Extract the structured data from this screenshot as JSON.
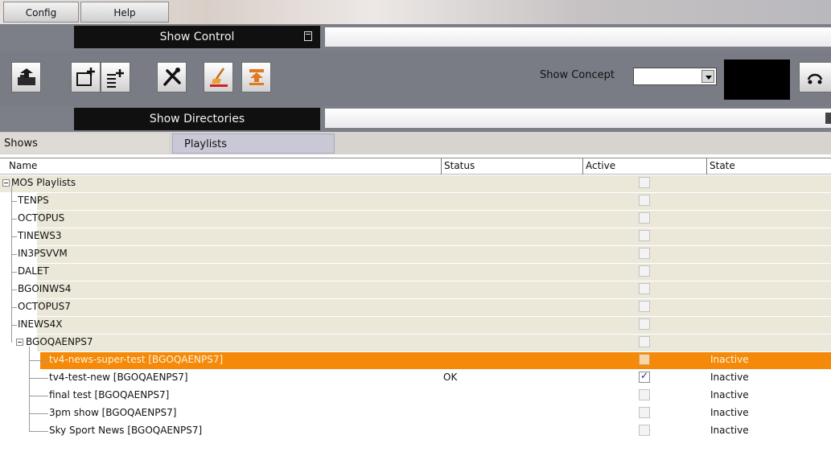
{
  "menu": {
    "config": "Config",
    "help": "Help"
  },
  "show_control": {
    "title": "Show Control",
    "minimize_icon": "window-restore-icon"
  },
  "toolbar": {
    "buttons": [
      {
        "name": "export-button",
        "icon": "export-icon"
      },
      {
        "name": "add-show-button",
        "icon": "add-window-icon"
      },
      {
        "name": "add-playlist-button",
        "icon": "add-list-icon"
      },
      {
        "name": "tools-button",
        "icon": "tools-icon"
      },
      {
        "name": "clean-button",
        "icon": "broom-icon"
      },
      {
        "name": "import-button",
        "icon": "import-icon"
      }
    ],
    "show_concept_label": "Show Concept",
    "show_concept_value": "",
    "end_icon": "disconnect-icon"
  },
  "show_directories": {
    "title": "Show Directories"
  },
  "tabs": {
    "shows": "Shows",
    "playlists": "Playlists"
  },
  "table": {
    "columns": [
      "Name",
      "Status",
      "Active",
      "State"
    ],
    "root": "MOS Playlists",
    "groups": [
      "TENPS",
      "OCTOPUS",
      "TINEWS3",
      "IN3PSVVM",
      "DALET",
      "BGOINWS4",
      "OCTOPUS7",
      "INEWS4X"
    ],
    "expanded_group": "BGOQAENPS7",
    "playlists": [
      {
        "name": "tv4-news-super-test [BGOQAENPS7]",
        "status": "",
        "active": false,
        "state": "Inactive",
        "selected": true
      },
      {
        "name": "tv4-test-new [BGOQAENPS7]",
        "status": "OK",
        "active": true,
        "state": "Inactive",
        "selected": false
      },
      {
        "name": "final test [BGOQAENPS7]",
        "status": "",
        "active": false,
        "state": "Inactive",
        "selected": false
      },
      {
        "name": "3pm show [BGOQAENPS7]",
        "status": "",
        "active": false,
        "state": "Inactive",
        "selected": false
      },
      {
        "name": "Sky Sport News [BGOQAENPS7]",
        "status": "",
        "active": false,
        "state": "Inactive",
        "selected": false
      }
    ]
  },
  "colors": {
    "group_row": "#ebe8da",
    "selected_row": "#f58a0a",
    "panel_bar": "#7d7f88"
  }
}
